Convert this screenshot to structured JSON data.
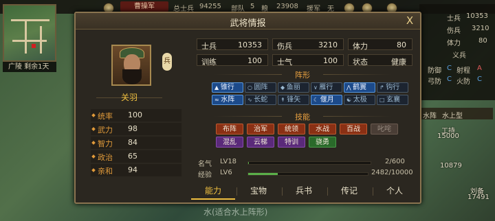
{
  "top_bar": {
    "faction": "曹操军",
    "total_troops_label": "总士兵",
    "total_troops": "94255",
    "units_label": "部队",
    "units": "5",
    "food_label": "粮",
    "food": "23908",
    "reinforce_label": "援军",
    "reinforce": "无"
  },
  "minimap": {
    "caption": "广陵 剩余1天"
  },
  "right_panel": {
    "troops_label": "士兵",
    "troops": "10353",
    "wounded_label": "伤兵",
    "wounded": "3210",
    "stamina_label": "体力",
    "stamina": "80",
    "unit_label": "义兵",
    "defense_label": "防御",
    "defense_grade": "C",
    "shoot_label": "射程",
    "shoot_grade": "A",
    "bow_label": "弓防",
    "bow_grade": "C",
    "fire_label": "火防",
    "fire_grade": "C",
    "tag_left": "水阵",
    "tag_right": "水上型"
  },
  "map": {
    "army_label": "工持",
    "army_value": "15000",
    "army2_value": "10879",
    "army3_label": "刘备",
    "army3_value": "17491"
  },
  "dialog": {
    "title": "武将情报",
    "close": "X",
    "type_badge": "兵",
    "name": "关羽",
    "attributes": [
      {
        "label": "统率",
        "value": "100"
      },
      {
        "label": "武力",
        "value": "98"
      },
      {
        "label": "智力",
        "value": "84"
      },
      {
        "label": "政治",
        "value": "65"
      },
      {
        "label": "亲和",
        "value": "94"
      }
    ],
    "stats": [
      {
        "label": "士兵",
        "value": "10353"
      },
      {
        "label": "伤兵",
        "value": "3210"
      },
      {
        "label": "体力",
        "value": "80"
      },
      {
        "label": "训练",
        "value": "100"
      },
      {
        "label": "士气",
        "value": "100"
      },
      {
        "label": "状态",
        "value": "健康"
      }
    ],
    "formation_title": "阵形",
    "formations": [
      {
        "label": "锥行",
        "icon": "arrow-up-icon",
        "active": true
      },
      {
        "label": "圆阵",
        "icon": "circle-icon",
        "active": false
      },
      {
        "label": "鱼丽",
        "icon": "fish-icon",
        "active": false
      },
      {
        "label": "雁行",
        "icon": "v-formation-icon",
        "active": false
      },
      {
        "label": "鹤翼",
        "icon": "wing-icon",
        "active": true
      },
      {
        "label": "钩行",
        "icon": "hook-icon",
        "active": false
      },
      {
        "label": "水阵",
        "icon": "water-icon",
        "active": true
      },
      {
        "label": "长蛇",
        "icon": "snake-icon",
        "active": false
      },
      {
        "label": "锋矢",
        "icon": "spear-icon",
        "active": false
      },
      {
        "label": "偃月",
        "icon": "moon-icon",
        "active": true
      },
      {
        "label": "太极",
        "icon": "taiji-icon",
        "active": false
      },
      {
        "label": "玄襄",
        "icon": "square-icon",
        "active": false
      }
    ],
    "skills_title": "技能",
    "skills": [
      {
        "label": "布阵",
        "color": "red"
      },
      {
        "label": "治军",
        "color": "red"
      },
      {
        "label": "统领",
        "color": "red"
      },
      {
        "label": "水战",
        "color": "red"
      },
      {
        "label": "百战",
        "color": "red"
      },
      {
        "label": "叱咤",
        "color": "gray"
      },
      {
        "label": "混乱",
        "color": "purple"
      },
      {
        "label": "云梯",
        "color": "purple"
      },
      {
        "label": "特训",
        "color": "purple"
      },
      {
        "label": "骁勇",
        "color": "green"
      }
    ],
    "fame": {
      "label": "名气",
      "level": "LV18",
      "progress_text": "2/600",
      "progress": 0.0033
    },
    "exp": {
      "label": "经验",
      "level": "LV6",
      "progress_text": "2482/10000",
      "progress": 0.2482
    },
    "tabs": [
      "能力",
      "宝物",
      "兵书",
      "传记",
      "个人"
    ],
    "active_tab": 0
  },
  "bottom_note": "水(适合水上阵形)"
}
